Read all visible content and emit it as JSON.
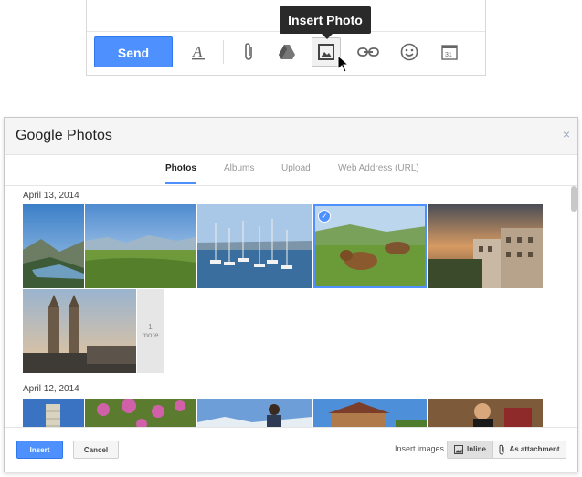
{
  "toolbar": {
    "send_label": "Send",
    "tooltip": "Insert Photo",
    "icons": [
      "text-format-icon",
      "attach-icon",
      "drive-icon",
      "insert-photo-icon",
      "link-icon",
      "emoji-icon",
      "calendar-icon"
    ],
    "calendar_day": "31"
  },
  "dialog": {
    "title": "Google Photos",
    "close": "×",
    "tabs": [
      {
        "label": "Photos",
        "active": true
      },
      {
        "label": "Albums",
        "active": false
      },
      {
        "label": "Upload",
        "active": false
      },
      {
        "label": "Web Address (URL)",
        "active": false
      }
    ],
    "groups": [
      {
        "date": "April 13, 2014"
      },
      {
        "date": "April 12, 2014"
      }
    ],
    "more_tile": {
      "count": "1",
      "label": "more"
    },
    "footer": {
      "insert": "Insert",
      "cancel": "Cancel",
      "insert_images_label": "Insert images",
      "inline": "Inline",
      "as_attachment": "As attachment"
    }
  },
  "colors": {
    "accent": "#4d90fe",
    "tooltip_bg": "#2a2a2a"
  }
}
